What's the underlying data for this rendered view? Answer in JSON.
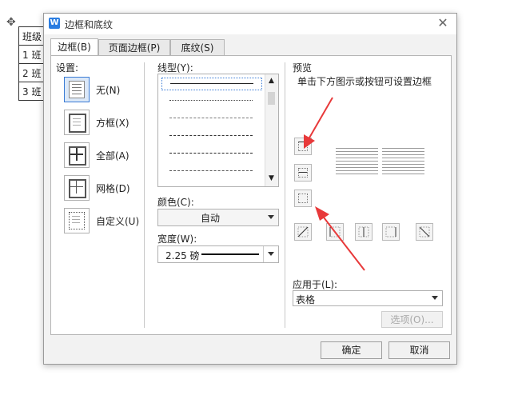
{
  "document": {
    "rows": [
      "班级",
      "1 班",
      "2 班",
      "3 班"
    ]
  },
  "dialog": {
    "title": "边框和底纹",
    "app_icon": "W",
    "close_label": "✕",
    "tabs": [
      {
        "label": "边框(B)",
        "active": true
      },
      {
        "label": "页面边框(P)",
        "active": false
      },
      {
        "label": "底纹(S)",
        "active": false
      }
    ],
    "settings": {
      "heading": "设置:",
      "items": [
        {
          "label": "无(N)",
          "icon": "none-border-icon",
          "selected": true
        },
        {
          "label": "方框(X)",
          "icon": "box-border-icon",
          "selected": false
        },
        {
          "label": "全部(A)",
          "icon": "all-borders-icon",
          "selected": false
        },
        {
          "label": "网格(D)",
          "icon": "grid-border-icon",
          "selected": false
        },
        {
          "label": "自定义(U)",
          "icon": "custom-border-icon",
          "selected": false
        }
      ]
    },
    "line_style": {
      "heading": "线型(Y):",
      "styles": [
        "solid",
        "dotted",
        "dashed-fine",
        "dashed",
        "dash-dot",
        "dash-dot-dot"
      ],
      "selected_index": 0
    },
    "color": {
      "label": "颜色(C):",
      "value": "自动"
    },
    "width": {
      "label": "宽度(W):",
      "value": "2.25 磅"
    },
    "preview": {
      "heading": "预览",
      "hint": "单击下方图示或按钮可设置边框"
    },
    "apply_to": {
      "label": "应用于(L):",
      "value": "表格"
    },
    "options_button": "选项(O)...",
    "ok_button": "确定",
    "cancel_button": "取消"
  },
  "colors": {
    "accent": "#3a7bd5",
    "annotation_arrow": "#e8393a",
    "app_icon": "#2b7de1"
  }
}
